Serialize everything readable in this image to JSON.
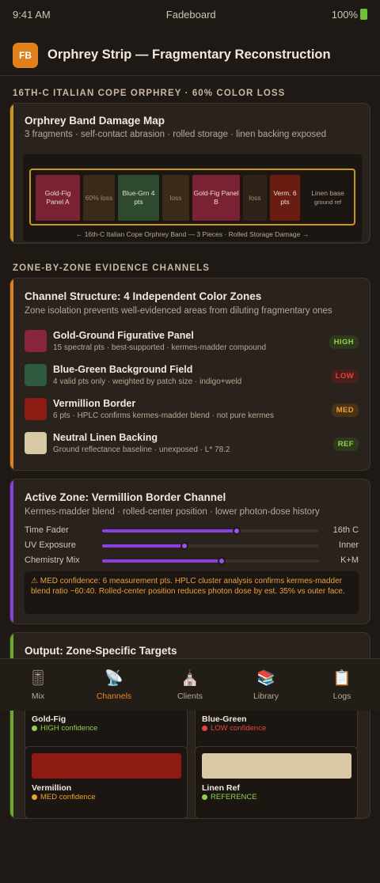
{
  "status_bar": {
    "time": "9:41 AM",
    "app": "Fadeboard",
    "battery": "100%"
  },
  "header": {
    "logo": "FB",
    "title": "Orphrey Strip — Fragmentary Reconstruction"
  },
  "section1": {
    "label": "16TH-C ITALIAN COPE ORPHREY · 60% COLOR LOSS"
  },
  "damage_map": {
    "title": "Orphrey Band Damage Map",
    "subtitle": "3 fragments · self-contact abrasion · rolled storage · linen backing exposed",
    "segments": [
      {
        "label": "Gold-Fig Panel A",
        "color": "#7a2233"
      },
      {
        "label": "60% loss",
        "color": "#3a2b18"
      },
      {
        "label": "Blue-Grn 4 pts",
        "color": "#2d4a2e"
      },
      {
        "label": "loss",
        "color": "#3a2b18"
      },
      {
        "label": "Gold-Fig Panel B",
        "color": "#7a2233"
      },
      {
        "label": "loss",
        "color": "#2f2218"
      },
      {
        "label": "Verm. 6 pts",
        "color": "#6b1c12"
      },
      {
        "label": "Linen base",
        "sublabel": "ground ref",
        "color": "#1b1612"
      }
    ],
    "caption": "← 16th-C Italian Cope Orphrey Band — 3 Pieces · Rolled Storage Damage →"
  },
  "section2": {
    "label": "ZONE-BY-ZONE EVIDENCE CHANNELS"
  },
  "channels": {
    "title": "Channel Structure: 4 Independent Color Zones",
    "subtitle": "Zone isolation prevents well-evidenced areas from diluting fragmentary ones",
    "zones": [
      {
        "name": "Gold-Ground Figurative Panel",
        "desc": "15 spectral pts · best-supported · kermes-madder compound",
        "badge": "HIGH",
        "swatch": "#8a2540",
        "badge_fg": "#8fd14f",
        "badge_bg": "#2f3a1c"
      },
      {
        "name": "Blue-Green Background Field",
        "desc": "4 valid pts only · weighted by patch size · indigo+weld",
        "badge": "LOW",
        "swatch": "#2e5a40",
        "badge_fg": "#e5453a",
        "badge_bg": "#4a1e1a"
      },
      {
        "name": "Vermillion Border",
        "desc": "6 pts · HPLC confirms kermes-madder blend · not pure kermes",
        "badge": "MED",
        "swatch": "#8e1a14",
        "badge_fg": "#f0a030",
        "badge_bg": "#4a3216"
      },
      {
        "name": "Neutral Linen Backing",
        "desc": "Ground reflectance baseline · unexposed · L* 78.2",
        "badge": "REF",
        "swatch": "#d8c9a4",
        "badge_fg": "#8fd14f",
        "badge_bg": "#2f3a1c"
      }
    ]
  },
  "active_zone": {
    "title": "Active Zone: Vermillion Border Channel",
    "subtitle": "Kermes-madder blend · rolled-center position · lower photon-dose history",
    "sliders": [
      {
        "label": "Time Fader",
        "value": "16th C",
        "level": 0.62
      },
      {
        "label": "UV Exposure",
        "value": "Inner",
        "level": 0.38
      },
      {
        "label": "Chemistry Mix",
        "value": "K+M",
        "level": 0.55
      }
    ],
    "note": "⚠ MED confidence: 6 measurement pts. HPLC cluster analysis confirms kermes-madder blend ratio ~60:40. Rolled-center position reduces photon dose by est. 35% vs outer face."
  },
  "output": {
    "title": "Output: Zone-Specific Targets",
    "targets": [
      {
        "name": "Gold-Fig",
        "confidence": "HIGH confidence",
        "swatch": "#7a2233",
        "dot": "#8fd14f"
      },
      {
        "name": "Blue-Green",
        "confidence": "LOW confidence",
        "swatch": "#2e5a40",
        "dot": "#e5453a"
      },
      {
        "name": "Vermillion",
        "confidence": "MED confidence",
        "swatch": "#8e1a14",
        "dot": "#f0a030"
      },
      {
        "name": "Linen Ref",
        "confidence": "REFERENCE",
        "swatch": "#d8c9a4",
        "dot": "#8fd14f"
      }
    ]
  },
  "tabbar": {
    "active": "Channels",
    "tabs": [
      {
        "label": "Mix",
        "icon": "mixer-icon",
        "glyph": "🎚"
      },
      {
        "label": "Channels",
        "icon": "satellite-icon",
        "glyph": "📡"
      },
      {
        "label": "Clients",
        "icon": "church-icon",
        "glyph": "⛪"
      },
      {
        "label": "Library",
        "icon": "books-icon",
        "glyph": "📚"
      },
      {
        "label": "Logs",
        "icon": "clipboard-icon",
        "glyph": "📋"
      }
    ]
  }
}
